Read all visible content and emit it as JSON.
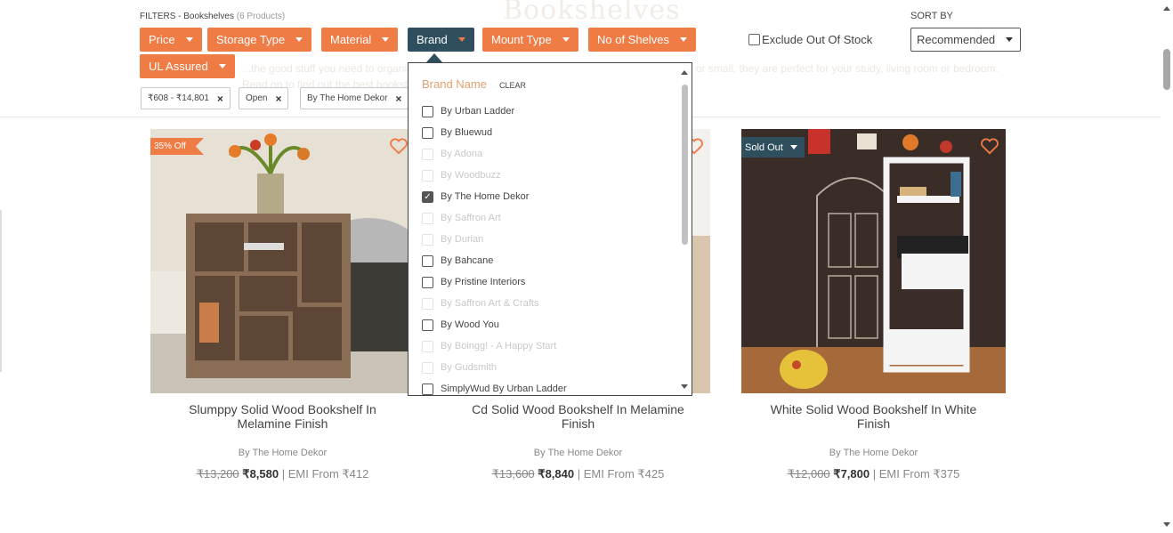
{
  "background": {
    "title": "Bookshelves",
    "description": "...the good stuff you need to organise your books and display your curio collection. Wooden, tall or small, they are perfect for your study, living room or bedroom. Read on to find out the best bookshelf designs for your home with functionality and style."
  },
  "filters": {
    "label": "FILTERS - Bookshelves",
    "count": "(6 Products)",
    "buttons": [
      "Price",
      "Storage Type",
      "Material",
      "Brand",
      "Mount Type",
      "No of Shelves",
      "UL Assured"
    ],
    "active": "Brand",
    "applied": [
      "₹608 - ₹14,801",
      "Open",
      "By The Home Dekor"
    ],
    "remove_glyph": "×"
  },
  "exclude_out_of_stock": {
    "label": "Exclude Out Of Stock",
    "checked": false
  },
  "sort": {
    "label": "SORT BY",
    "value": "Recommended"
  },
  "brand_dropdown": {
    "title": "Brand Name",
    "clear_label": "CLEAR",
    "items": [
      {
        "label": "By Urban Ladder",
        "checked": false,
        "disabled": false
      },
      {
        "label": "By Bluewud",
        "checked": false,
        "disabled": false
      },
      {
        "label": "By Adona",
        "checked": false,
        "disabled": true
      },
      {
        "label": "By Woodbuzz",
        "checked": false,
        "disabled": true
      },
      {
        "label": "By The Home Dekor",
        "checked": true,
        "disabled": false
      },
      {
        "label": "By Saffron Art",
        "checked": false,
        "disabled": true
      },
      {
        "label": "By Durian",
        "checked": false,
        "disabled": true
      },
      {
        "label": "By Bahcane",
        "checked": false,
        "disabled": false
      },
      {
        "label": "By Pristine Interiors",
        "checked": false,
        "disabled": false
      },
      {
        "label": "By Saffron Art & Crafts",
        "checked": false,
        "disabled": true
      },
      {
        "label": "By Wood You",
        "checked": false,
        "disabled": false
      },
      {
        "label": "By Boingg! - A Happy Start",
        "checked": false,
        "disabled": true
      },
      {
        "label": "By Gudsmith",
        "checked": false,
        "disabled": true
      },
      {
        "label": "SimplyWud By Urban Ladder",
        "checked": false,
        "disabled": false
      }
    ]
  },
  "products": [
    {
      "name": "Slumppy Solid Wood Bookshelf In Melamine Finish",
      "brand": "By The Home Dekor",
      "old_price": "₹13,200",
      "price": "₹8,580",
      "emi": "| EMI From ₹412",
      "badge": "35% Off",
      "badge_type": "discount",
      "image": "wooden-bookshelf-photo"
    },
    {
      "name": "Cd Solid Wood Bookshelf In Melamine Finish",
      "brand": "By The Home Dekor",
      "old_price": "₹13,600",
      "price": "₹8,840",
      "emi": "| EMI From ₹425",
      "badge": "",
      "badge_type": "",
      "image": "cd-bookshelf-photo"
    },
    {
      "name": "White Solid Wood Bookshelf In White Finish",
      "brand": "By The Home Dekor",
      "old_price": "₹12,000",
      "price": "₹7,800",
      "emi": "| EMI From ₹375",
      "badge": "Sold Out",
      "badge_type": "soldout",
      "image": "white-ladder-bookshelf-photo"
    }
  ],
  "colors": {
    "accent": "#ef7b45",
    "dark": "#2f4f5f"
  },
  "icons": {
    "wishlist": "heart-icon",
    "remove": "close-icon",
    "dropdown": "chevron-down-icon"
  }
}
